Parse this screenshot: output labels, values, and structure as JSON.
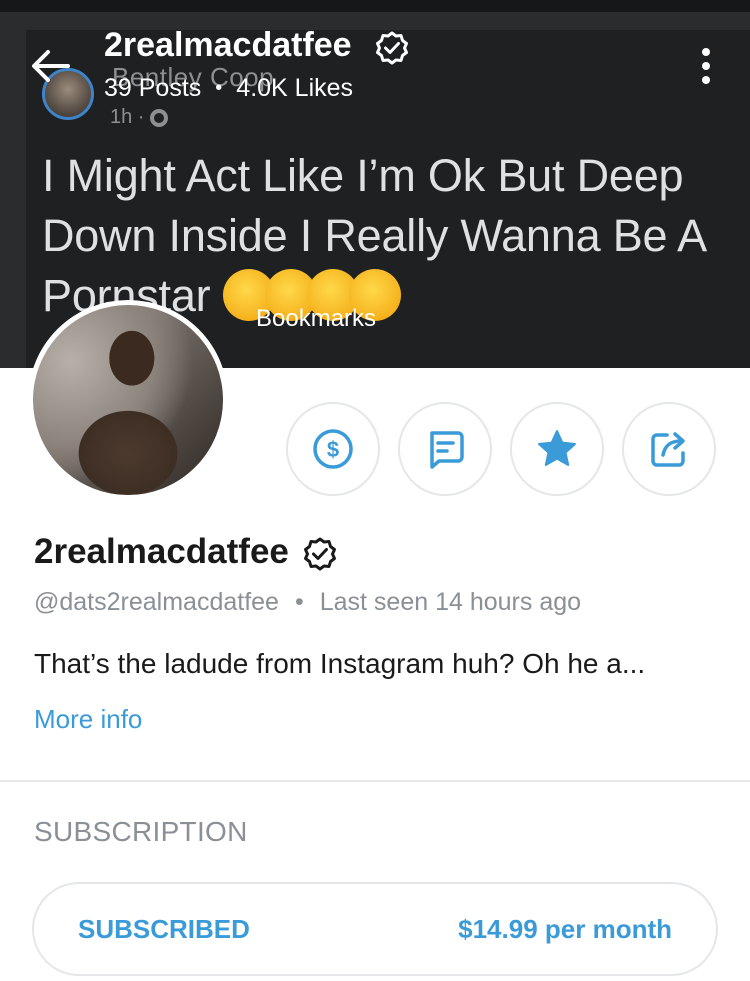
{
  "cover": {
    "original_author": "Bentley Coop",
    "original_time": "1h ·",
    "post_text": "I Might Act Like I’m Ok But Deep Down Inside I Really Wanna Be A Pornstar",
    "emojis": [
      "rolling-on-floor-laughing",
      "loudly-crying",
      "weary-face",
      "sneezing-face"
    ]
  },
  "header": {
    "username": "2realmacdatfee",
    "posts": "39 Posts",
    "separator": "•",
    "likes": "4.0K Likes"
  },
  "overlay_label": "Bookmarks",
  "actions": [
    {
      "name": "tip-button",
      "icon": "dollar-icon"
    },
    {
      "name": "message-button",
      "icon": "message-icon"
    },
    {
      "name": "favorite-button",
      "icon": "star-icon"
    },
    {
      "name": "share-button",
      "icon": "share-icon"
    }
  ],
  "profile": {
    "display_name": "2realmacdatfee",
    "handle": "@dats2realmacdatfee",
    "separator": "•",
    "last_seen": "Last seen 14 hours ago",
    "bio": "That’s the ladude from Instagram huh? Oh he a...",
    "more_info": "More info"
  },
  "subscription": {
    "title": "SUBSCRIPTION",
    "status": "SUBSCRIBED",
    "price": "$14.99 per month"
  },
  "colors": {
    "accent": "#3a9bd8",
    "cover_bg": "#2b2c2e",
    "muted_text": "#8a9096"
  }
}
